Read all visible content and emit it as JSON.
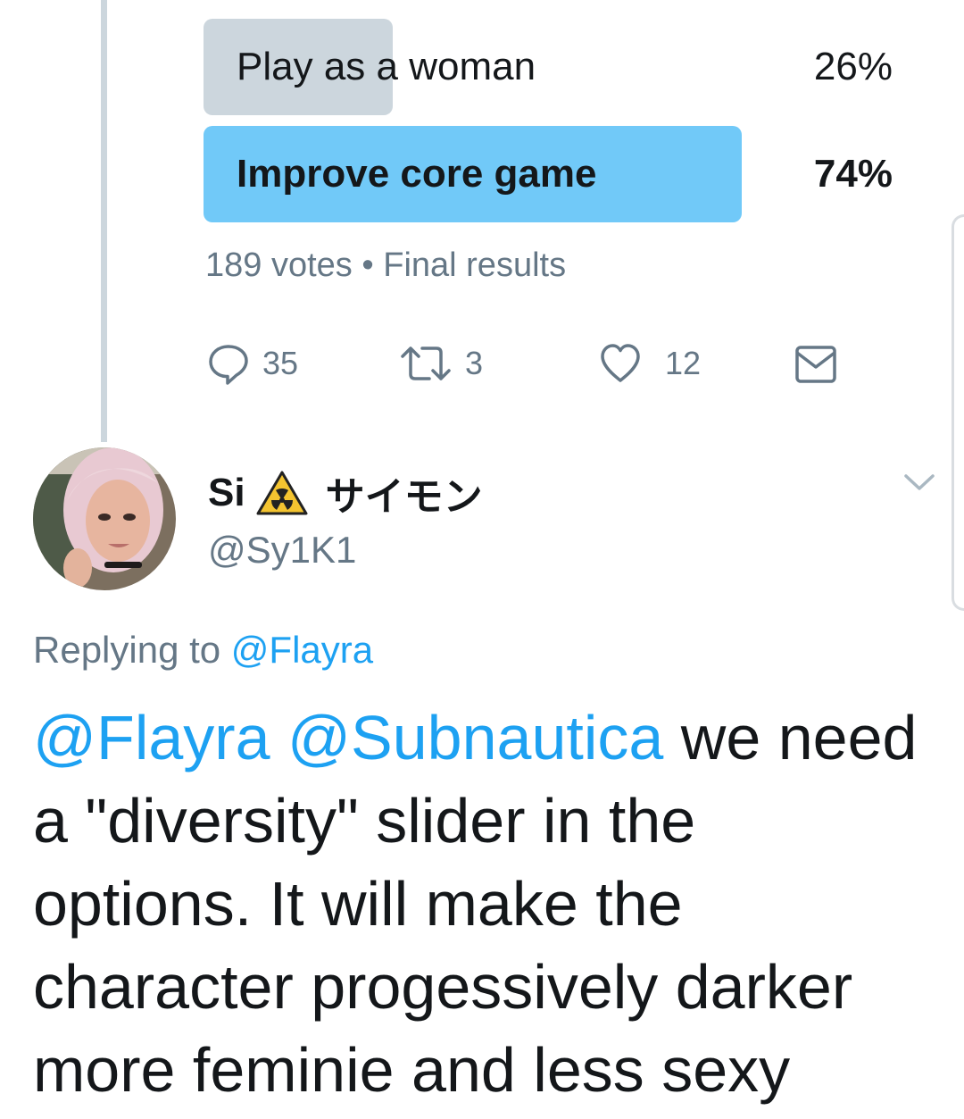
{
  "poll": {
    "options": [
      {
        "label": "Play as a woman",
        "percent": "26%",
        "fraction": 0.26
      },
      {
        "label": "Improve core game",
        "percent": "74%",
        "fraction": 0.74
      }
    ],
    "votes": "189 votes",
    "separator": "•",
    "status": "Final results"
  },
  "actions": {
    "replies": "35",
    "retweets": "3",
    "likes": "12"
  },
  "reply_tweet": {
    "display_name": "Si",
    "display_name_suffix": "サイモン",
    "handle": "@Sy1K1",
    "replying_prefix": "Replying to",
    "replying_to": "@Flayra",
    "mention_1": "@Flayra",
    "mention_2": "@Subnautica",
    "text": "we need a \"diversity\" slider in the options. It will make the character progessively darker more feminie and less sexy"
  },
  "colors": {
    "accent": "#1da1f2",
    "poll_winner": "#71c9f8",
    "poll_other": "#ccd6dd",
    "muted": "#657786"
  },
  "icons": [
    "reply-icon",
    "retweet-icon",
    "heart-icon",
    "message-icon",
    "radioactive-warning-icon",
    "chevron-down-icon"
  ]
}
